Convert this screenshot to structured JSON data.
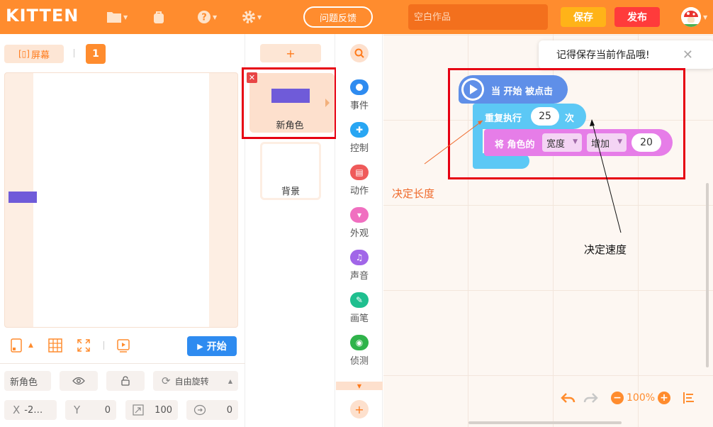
{
  "app": {
    "logo": "KITTEN",
    "feedback_label": "问题反馈",
    "title_placeholder": "空白作品",
    "save_label": "保存",
    "publish_label": "发布"
  },
  "stage": {
    "fullscreen_label": "屏幕",
    "page_number": "1",
    "start_label": "开始"
  },
  "sprite_props": {
    "name": "新角色",
    "rotation_label": "自由旋转",
    "x_label": "X",
    "x_value": "-2…",
    "y_label": "Y",
    "y_value": "0",
    "scale_value": "100",
    "direction_value": "0"
  },
  "sprites": {
    "add_label": "+",
    "items": [
      {
        "label": "新角色"
      }
    ],
    "background_label": "背景"
  },
  "categories": [
    {
      "label": "事件",
      "color": "#2e8bf0",
      "icon": "event-icon"
    },
    {
      "label": "控制",
      "color": "#28a6f3",
      "icon": "control-icon"
    },
    {
      "label": "动作",
      "color": "#ef5a5a",
      "icon": "motion-icon"
    },
    {
      "label": "外观",
      "color": "#f06fc0",
      "icon": "looks-icon"
    },
    {
      "label": "声音",
      "color": "#a166e8",
      "icon": "sound-icon"
    },
    {
      "label": "画笔",
      "color": "#1fbf8f",
      "icon": "pen-icon"
    },
    {
      "label": "侦测",
      "color": "#2fb34a",
      "icon": "sensing-icon"
    }
  ],
  "workspace": {
    "toast": "记得保存当前作品哦!",
    "zoom": "100%",
    "blocks": {
      "hat": "当 开始 被点击",
      "repeat_label": "重复执行",
      "repeat_count": "25",
      "repeat_suffix": "次",
      "set_label": "将 角色的",
      "property": "宽度",
      "operation": "增加",
      "amount": "20"
    },
    "annotations": {
      "length": "决定长度",
      "speed": "决定速度"
    }
  },
  "colors": {
    "brand": "#ff8c2e",
    "highlight_frame": "#e60012"
  }
}
